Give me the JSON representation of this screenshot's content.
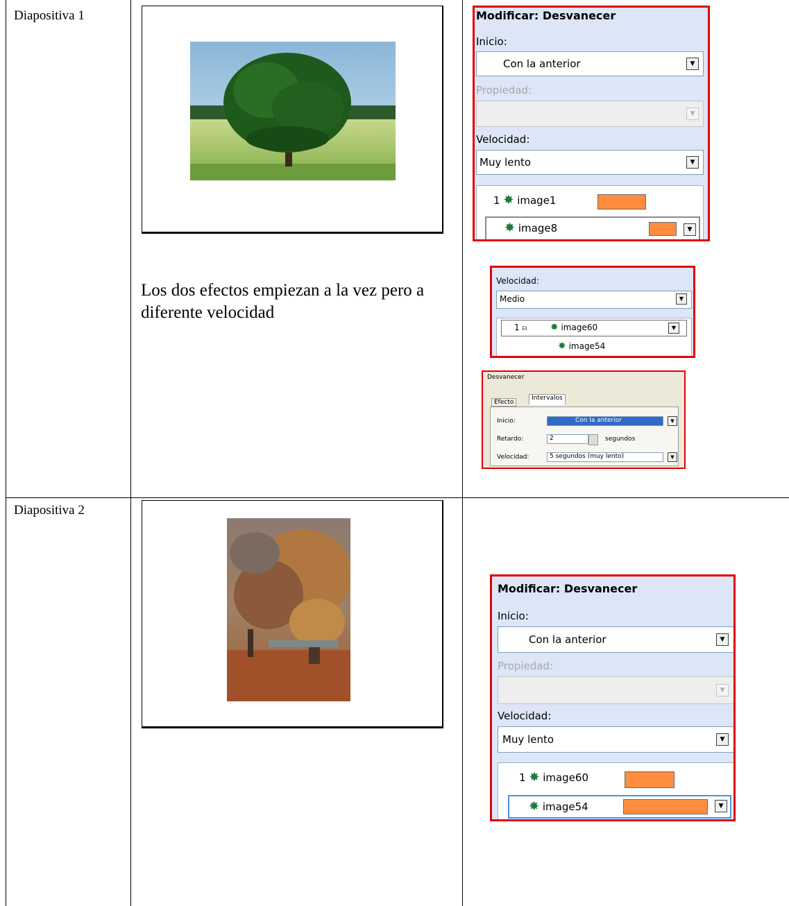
{
  "rows": [
    {
      "label": "Diapositiva 1",
      "caption": "Los dos efectos empiezan a la vez pero a diferente velocidad",
      "image_desc": "tree-photo",
      "panel": {
        "title": "Modificar: Desvanecer",
        "inicio_label": "Inicio:",
        "inicio_value": "Con la anterior",
        "propiedad_label": "Propiedad:",
        "velocidad_label": "Velocidad:",
        "velocidad_value": "Muy lento",
        "items": [
          {
            "num": "1",
            "name": "image1"
          },
          {
            "num": "",
            "name": "image8"
          }
        ]
      },
      "mini_panel": {
        "velocidad_label": "Velocidad:",
        "velocidad_value": "Medio",
        "items": [
          {
            "num": "1",
            "name": "image60"
          },
          {
            "num": "",
            "name": "image54"
          }
        ]
      },
      "dialog": {
        "title": "Desvanecer",
        "tabs": [
          "Efecto",
          "Intervalos"
        ],
        "inicio_label": "Inicio:",
        "inicio_value": "Con la anterior",
        "retardo_label": "Retardo:",
        "retardo_value": "2",
        "retardo_unit": "segundos",
        "velocidad_label": "Velocidad:",
        "velocidad_value": "5 segundos (muy lento)"
      }
    },
    {
      "label": "Diapositiva 2",
      "image_desc": "autumn-tree-photo",
      "panel": {
        "title": "Modificar: Desvanecer",
        "inicio_label": "Inicio:",
        "inicio_value": "Con la anterior",
        "propiedad_label": "Propiedad:",
        "velocidad_label": "Velocidad:",
        "velocidad_value": "Muy lento",
        "items": [
          {
            "num": "1",
            "name": "image60"
          },
          {
            "num": "",
            "name": "image54"
          }
        ]
      }
    }
  ],
  "icons": {
    "effect": "fade-star-icon",
    "dropdown": "chevron-down-icon",
    "mouse": "mouse-click-icon"
  },
  "colors": {
    "highlight_border": "#e00000",
    "panel_bg": "#dce6f7",
    "timeline_bar": "#ff8c3f",
    "star": "#1e7a3a"
  }
}
